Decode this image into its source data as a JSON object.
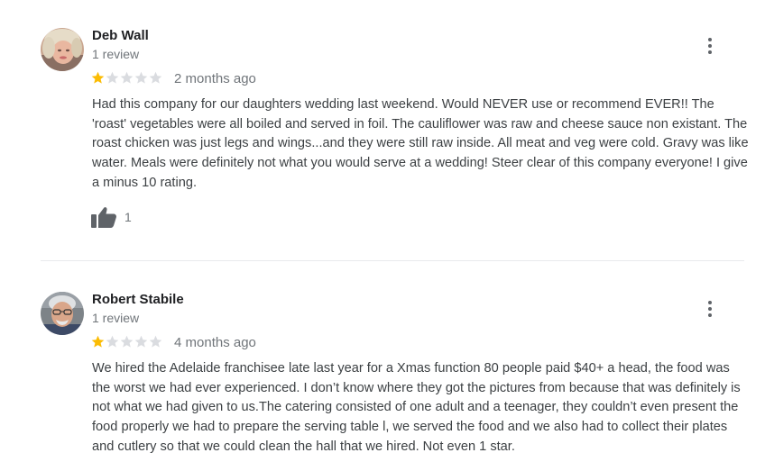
{
  "reviews": [
    {
      "name": "Deb Wall",
      "review_count": "1 review",
      "rating": 1,
      "max_rating": 5,
      "time": "2 months ago",
      "text": "Had this company for our daughters wedding last weekend. Would NEVER use or recommend EVER!! The 'roast' vegetables were all boiled and served in foil. The cauliflower was raw and cheese sauce non existant. The roast chicken was just legs and wings...and they were still raw inside. All meat and veg were cold. Gravy was like water. Meals were definitely not what you would serve at a wedding! Steer clear of this company everyone! I give a minus 10 rating.",
      "likes": "1",
      "menu_icon": "more-vert-icon",
      "like_icon": "thumbs-up-icon"
    },
    {
      "name": "Robert Stabile",
      "review_count": "1 review",
      "rating": 1,
      "max_rating": 5,
      "time": "4 months ago",
      "text": "We hired the Adelaide franchisee late last year for a Xmas function 80 people paid $40+ a head, the food was the worst we had ever experienced. I don’t know where they got the pictures from because that was definitely is not what we had given to us.The catering consisted of one adult and a teenager, they couldn’t even present the food properly we had to prepare the serving table l, we served the food and we also had to collect their plates and cutlery so that we could clean the hall that we hired. Not even 1 star.",
      "menu_icon": "more-vert-icon"
    }
  ],
  "colors": {
    "star_filled": "#fbbc04",
    "star_empty": "#dadce0",
    "secondary_text": "#70757a",
    "body_text": "#3c4043",
    "icon": "#5f6368"
  }
}
